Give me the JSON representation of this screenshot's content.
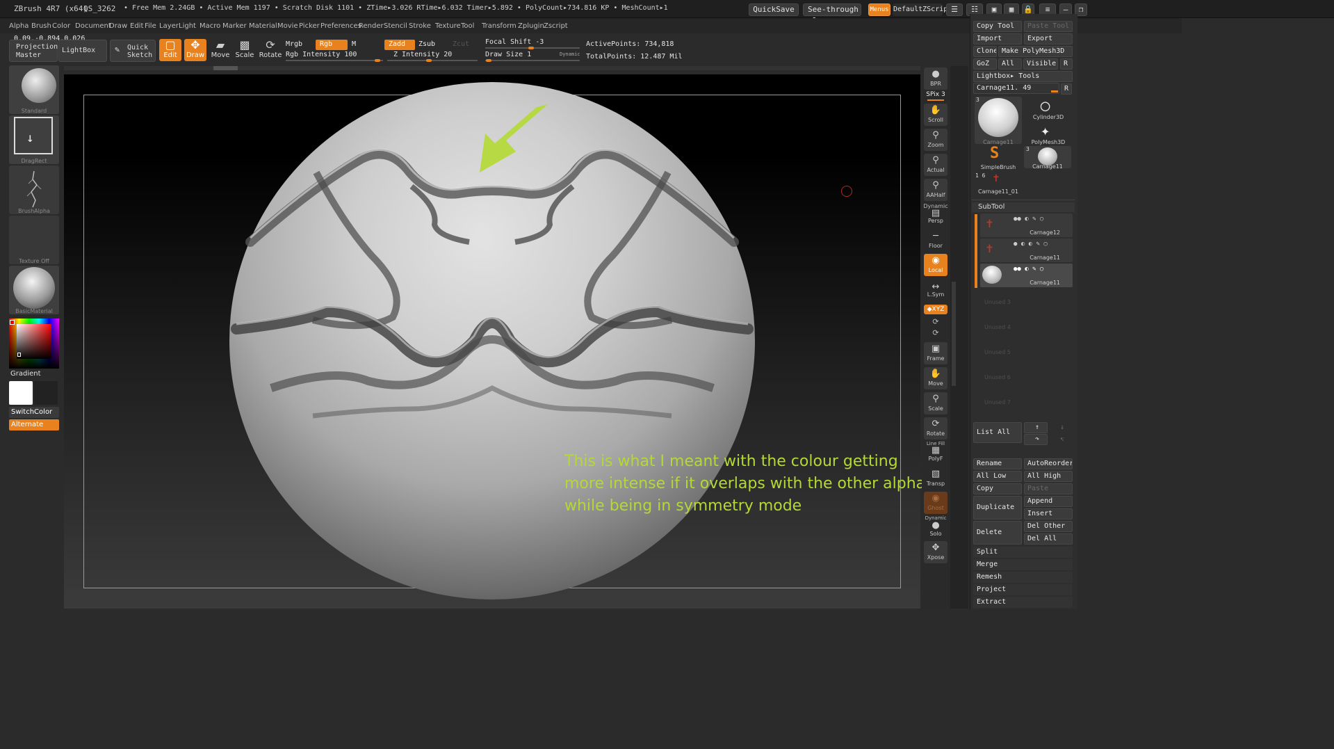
{
  "titlebar": {
    "app": "ZBrush 4R7 (x64)",
    "doc": "QS_3262",
    "stats": "• Free Mem 2.24GB • Active Mem 1197 • Scratch Disk 1101 • ZTime▸3.026 RTime▸6.032 Timer▸5.892 • PolyCount▸734.816 KP • MeshCount▸1",
    "quicksave": "QuickSave",
    "seethrough": "See-through",
    "seethrough_value": "0",
    "menus": "Menus",
    "script": "DefaultZScript"
  },
  "menubar": [
    "Alpha",
    "Brush",
    "Color",
    "Document",
    "Draw",
    "Edit",
    "File",
    "Layer",
    "Light",
    "Macro",
    "Marker",
    "Material",
    "Movie",
    "Picker",
    "Preferences",
    "Render",
    "Stencil",
    "Stroke",
    "Texture",
    "Tool",
    "Transform",
    "Zplugin",
    "Zscript"
  ],
  "coords": "0.09,-0.894,0.026",
  "shelf": {
    "projection_master": [
      "Projection",
      "Master"
    ],
    "lightbox": "LightBox",
    "quick_sketch": [
      "Quick",
      "Sketch"
    ],
    "edit": "Edit",
    "draw": "Draw",
    "move": "Move",
    "scale": "Scale",
    "rotate": "Rotate",
    "mrgb": "Mrgb",
    "rgb": "Rgb",
    "m": "M",
    "zadd": "Zadd",
    "zsub": "Zsub",
    "zcut": "Zcut",
    "rgb_intensity_label": "Rgb Intensity",
    "rgb_intensity": "100",
    "z_intensity_label": "Z Intensity",
    "z_intensity": "20",
    "focal_shift_label": "Focal Shift",
    "focal_shift": "-3",
    "draw_size_label": "Draw Size",
    "draw_size": "1",
    "dynamic": "Dynamic",
    "active_points_label": "ActivePoints:",
    "active_points": "734,818",
    "total_points_label": "TotalPoints:",
    "total_points": "12.487 Mil"
  },
  "left": {
    "standard": "Standard",
    "dragrect": "DragRect",
    "brushalpha": "BrushAlpha",
    "texture_off": "Texture Off",
    "basicmaterial": "BasicMaterial",
    "gradient": "Gradient",
    "switchcolor": "SwitchColor",
    "alternate": "Alternate"
  },
  "annotation": "This is what I meant with the colour getting more intense if it overlaps with the other alpha while being in symmetry mode",
  "right_toolbar": {
    "bpr": "BPR",
    "spix_label": "SPix",
    "spix": "3",
    "scroll": "Scroll",
    "zoom": "Zoom",
    "actual": "Actual",
    "aahalf": "AAHalf",
    "dynamic": "Dynamic",
    "persp": "Persp",
    "floor": "Floor",
    "local": "Local",
    "lsym": "L.Sym",
    "xyz": "◆XYZ",
    "frame": "Frame",
    "move": "Move",
    "scale": "Scale",
    "rotate": "Rotate",
    "linefill": "Line Fill",
    "polyf": "PolyF",
    "transp": "Transp",
    "ghost": "Ghost",
    "dynamic2": "Dynamic",
    "solo": "Solo",
    "xpose": "Xpose"
  },
  "tool_panel": {
    "copy_tool": "Copy Tool",
    "paste_tool": "Paste Tool",
    "import": "Import",
    "export": "Export",
    "clone": "Clone",
    "make_polymesh": "Make PolyMesh3D",
    "goz": "GoZ",
    "all": "All",
    "visible": "Visible",
    "r": "R",
    "lightbox_tools": "Lightbox▸ Tools",
    "current_tool": "Carnage11. 49",
    "thumbs": {
      "carnage_main": "Carnage11",
      "carnage_count": "3",
      "cylinder": "Cylinder3D",
      "polymesh": "PolyMesh3D",
      "simplebrush": "SimpleBrush",
      "carnage_small": "Carnage11",
      "carnage_small_count": "3",
      "count_16": "1 6",
      "carnage_01": "Carnage11_01"
    },
    "subtool": "SubTool",
    "subtools": [
      "Carnage12",
      "Carnage11",
      "Carnage11"
    ],
    "unused": [
      "Unused 3",
      "Unused 4",
      "Unused 5",
      "Unused 6",
      "Unused 7"
    ],
    "list_all": "List All",
    "rename": "Rename",
    "autoreorder": "AutoReorder",
    "all_low": "All Low",
    "all_high": "All High",
    "copy": "Copy",
    "paste": "Paste",
    "duplicate": "Duplicate",
    "append": "Append",
    "insert": "Insert",
    "delete": "Delete",
    "del_other": "Del Other",
    "del_all": "Del All",
    "split": "Split",
    "merge": "Merge",
    "remesh": "Remesh",
    "project": "Project",
    "extract": "Extract"
  },
  "colors": {
    "accent": "#e8821e",
    "annotation": "#b4d934"
  }
}
